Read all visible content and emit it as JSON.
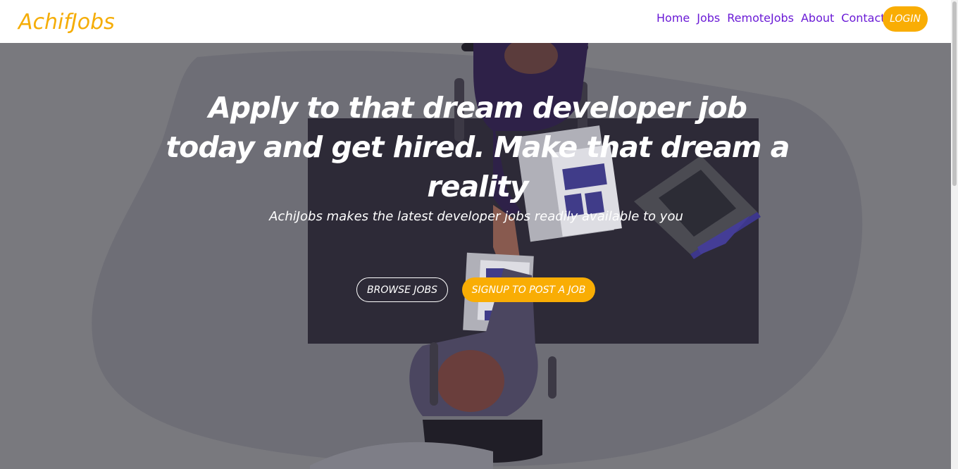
{
  "navbar": {
    "brand": "AchifJobs",
    "links": [
      "Home",
      "Jobs",
      "RemoteJobs",
      "About",
      "Contact"
    ],
    "login_label": "LOGIN"
  },
  "hero": {
    "headline": "Apply to that dream developer job today and get hired. Make that dream a reality",
    "subtitle": "AchiJobs makes the latest developer jobs readily available to you",
    "browse_label": "BROWSE JOBS",
    "signup_label": "SIGNUP TO POST A JOB"
  },
  "colors": {
    "accent": "#f9ad04",
    "nav_link": "#6a1ad6",
    "hero_bg": "#7b7b80"
  }
}
